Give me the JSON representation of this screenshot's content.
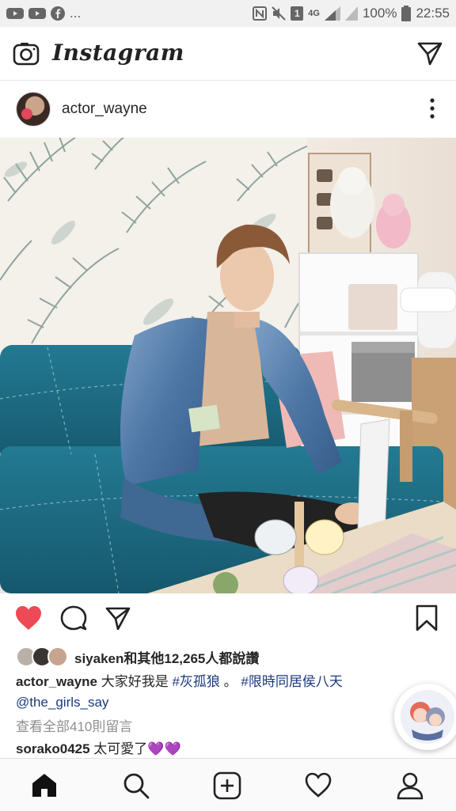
{
  "status_bar": {
    "left_more": "...",
    "network": "4G",
    "battery_percent": "100%",
    "time": "22:55",
    "sim_slot": "1"
  },
  "app": {
    "name": "Instagram"
  },
  "post": {
    "username": "actor_wayne",
    "liked": true,
    "likes_text": "siyaken和其他12,265人都說讚",
    "caption_user": "actor_wayne",
    "caption_text": " 大家好我是 ",
    "hashtag1": "#灰孤狼",
    "caption_sep": " 。 ",
    "hashtag2": "#限時同居侯八天",
    "mention": "@the_girls_say",
    "view_comments": "查看全部410則留言",
    "comment_user": "sorako0425",
    "comment_text": " 太可愛了💜💜"
  },
  "icons": {
    "camera": "camera-icon",
    "direct": "paper-plane-icon",
    "more": "more-vertical-icon",
    "like": "heart-icon",
    "comment": "comment-icon",
    "share": "share-icon",
    "save": "bookmark-icon",
    "home": "home-icon",
    "search": "search-icon",
    "add": "add-icon",
    "activity": "heart-outline-icon",
    "profile": "profile-icon"
  },
  "colors": {
    "like_red": "#ed4956",
    "link_blue": "#1a3a7a",
    "sofa_teal": "#1f6f86"
  }
}
